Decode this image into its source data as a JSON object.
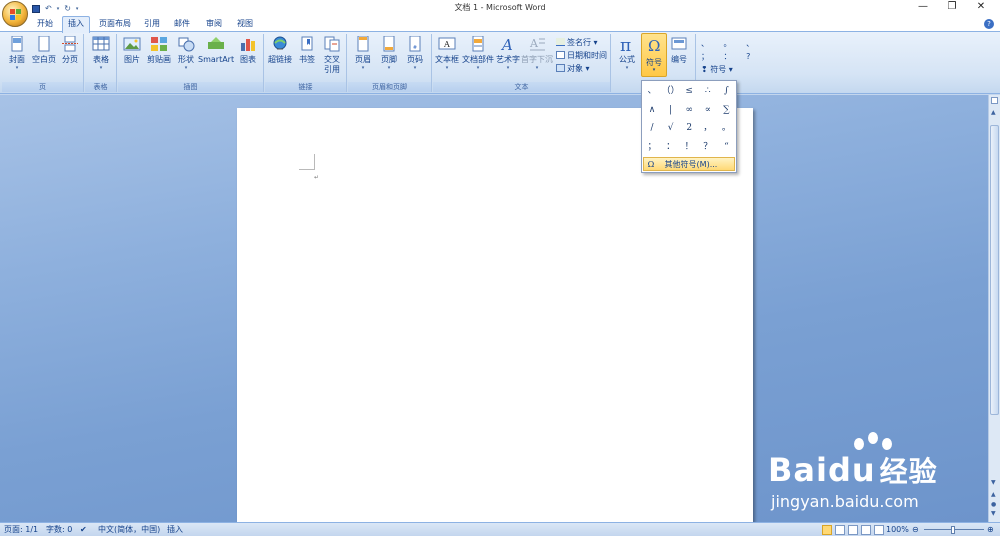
{
  "title_bar": {
    "title": "文档 1 - Microsoft Word",
    "quick_access": [
      "save-icon",
      "undo-icon",
      "redo-icon",
      "customize-icon"
    ],
    "window_controls": [
      "—",
      "❐",
      "✕"
    ]
  },
  "tabs": [
    {
      "label": "开始",
      "active": false
    },
    {
      "label": "插入",
      "active": true
    },
    {
      "label": "页面布局",
      "active": false
    },
    {
      "label": "引用",
      "active": false
    },
    {
      "label": "邮件",
      "active": false
    },
    {
      "label": "审阅",
      "active": false
    },
    {
      "label": "视图",
      "active": false
    }
  ],
  "ribbon": {
    "groups": {
      "pages": {
        "label": "页",
        "buttons": [
          "封面",
          "空白页",
          "分页"
        ]
      },
      "tables": {
        "label": "表格",
        "buttons": [
          "表格"
        ]
      },
      "illustrations": {
        "label": "插图",
        "buttons": [
          "图片",
          "剪贴画",
          "形状",
          "SmartArt",
          "图表"
        ]
      },
      "links": {
        "label": "链接",
        "buttons": [
          "超链接",
          "书签",
          "交叉",
          "引用"
        ]
      },
      "header_footer": {
        "label": "页眉和页脚",
        "buttons": [
          "页眉",
          "页脚",
          "页码"
        ]
      },
      "text": {
        "label": "文本",
        "buttons": [
          "文本框",
          "文档部件",
          "艺术字",
          "首字下沉"
        ],
        "small": [
          "签名行",
          "日期和时间",
          "对象"
        ]
      },
      "symbols": {
        "buttons": [
          "公式",
          "符号",
          "编号"
        ],
        "small_label": "符号"
      }
    }
  },
  "symbol_dropdown": {
    "symbols": [
      "、",
      "（）",
      "≤",
      "∴",
      "∫",
      "∧",
      "|",
      "∞",
      "∝",
      "∑",
      "/",
      "√",
      "2",
      "，",
      "。",
      "；",
      "：",
      "！",
      "？",
      "“"
    ],
    "more_label": "其他符号(M)..."
  },
  "status_bar": {
    "page": "页面: 1/1",
    "words": "字数: 0",
    "language": "中文(简体，中国)",
    "mode": "插入",
    "zoom": "100%"
  },
  "watermark": {
    "brand": "Baidu",
    "brand_cn": "经验",
    "url": "jingyan.baidu.com"
  }
}
